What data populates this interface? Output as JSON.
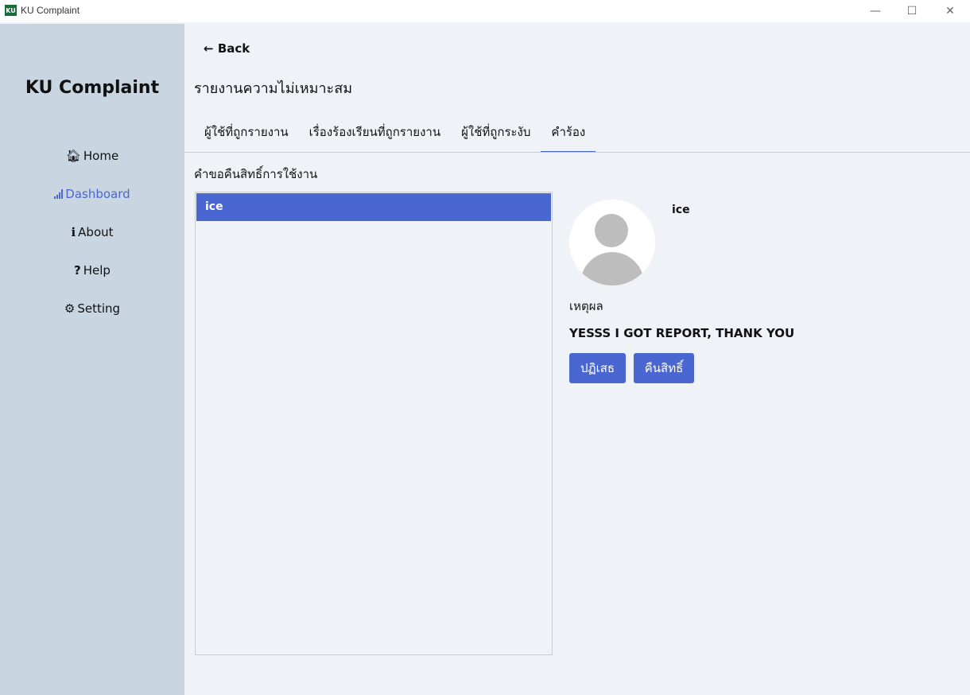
{
  "window": {
    "icon_text": "KU",
    "title": "KU Complaint",
    "minimize": "—",
    "maximize": "☐",
    "close": "✕"
  },
  "sidebar": {
    "brand": "KU Complaint",
    "items": [
      {
        "icon": "home-icon",
        "glyph": "🏠︎",
        "label": "Home"
      },
      {
        "icon": "signal-bars-icon",
        "glyph": "",
        "label": "Dashboard",
        "active": true
      },
      {
        "icon": "info-icon",
        "glyph": "ℹ",
        "label": "About"
      },
      {
        "icon": "question-icon",
        "glyph": "?",
        "label": "Help"
      },
      {
        "icon": "gear-icon",
        "glyph": "⚙",
        "label": "Setting"
      }
    ]
  },
  "main": {
    "back_label": "Back",
    "back_glyph": "←",
    "page_title": "รายงานความไม่เหมาะสม",
    "tabs": [
      {
        "label": "ผู้ใช้ที่ถูกรายงาน"
      },
      {
        "label": "เรื่องร้องเรียนที่ถูกรายงาน"
      },
      {
        "label": "ผู้ใช้ที่ถูกระงับ"
      },
      {
        "label": "คำร้อง",
        "active": true
      }
    ],
    "section_label": "คำขอคืนสิทธิ์การใช้งาน",
    "list_items": [
      "ice"
    ],
    "detail": {
      "user_name": "ice",
      "reason_label": "เหตุผล",
      "reason_text": "YESSS I GOT REPORT, THANK YOU",
      "reject_label": "ปฏิเสธ",
      "restore_label": "คืนสิทธิ์"
    }
  },
  "colors": {
    "accent": "#4a66d0",
    "sidebar_bg": "#c9d6e1",
    "content_bg": "#eff3f8"
  }
}
